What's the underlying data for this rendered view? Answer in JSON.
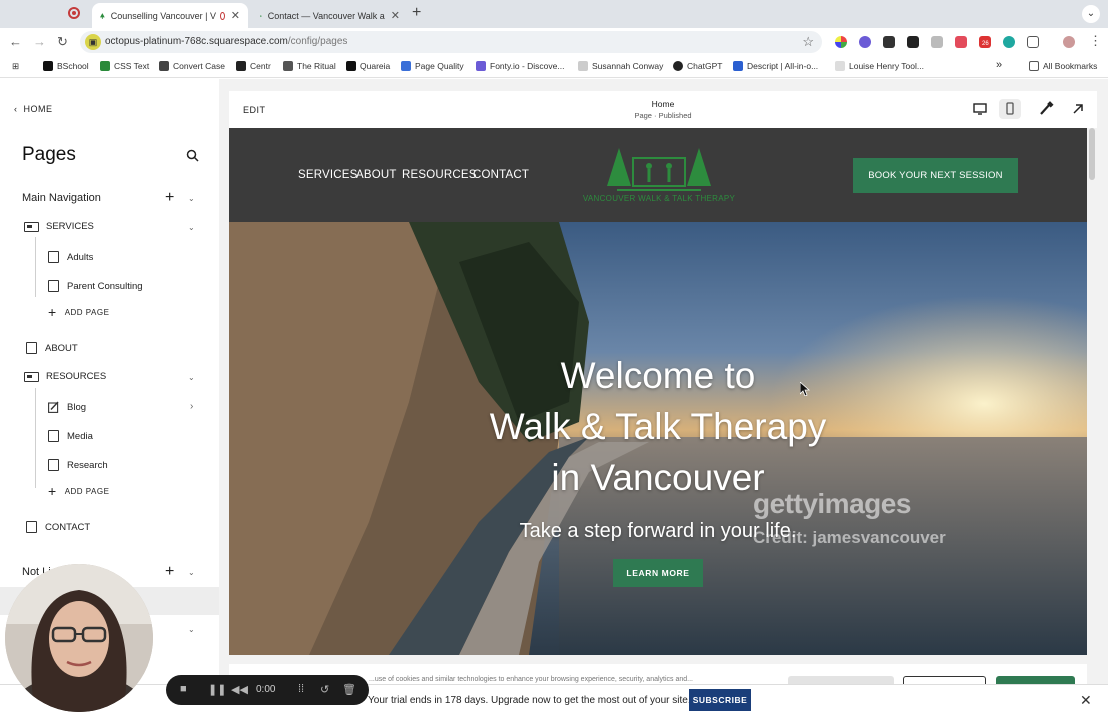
{
  "browser": {
    "tabs": [
      {
        "title": "Counselling Vancouver | V"
      },
      {
        "title": "Contact — Vancouver Walk a"
      }
    ],
    "new_tab": "+",
    "url_host": "octopus-platinum-768c.squarespace.com",
    "url_path": "/config/pages",
    "bookmarks": [
      "BSchool",
      "CSS Text",
      "Convert Case",
      "Centr",
      "The Ritual",
      "Quareia",
      "Page Quality",
      "Fonty.io - Discove...",
      "Susannah Conway",
      "ChatGPT",
      "Descript | All-in-o...",
      "Louise Henry Tool...",
      "All Bookmarks"
    ],
    "extension_badge": "26"
  },
  "sidebar": {
    "home_label": "HOME",
    "title": "Pages",
    "main_nav_label": "Main Navigation",
    "items": {
      "services": "SERVICES",
      "adults": "Adults",
      "parent_consulting": "Parent Consulting",
      "add_page_1": "ADD PAGE",
      "about": "ABOUT",
      "resources": "RESOURCES",
      "blog": "Blog",
      "media": "Media",
      "research": "Research",
      "add_page_2": "ADD PAGE",
      "contact": "CONTACT"
    },
    "not_linked_label": "Not Li"
  },
  "editor": {
    "edit_label": "EDIT",
    "page_name": "Home",
    "page_status": "Page · Published"
  },
  "site": {
    "nav": [
      "SERVICES",
      "ABOUT",
      "RESOURCES",
      "CONTACT"
    ],
    "logo_text": "VANCOUVER WALK & TALK THERAPY",
    "book_button": "BOOK YOUR NEXT SESSION",
    "hero_line1": "Welcome to",
    "hero_line2": "Walk & Talk Therapy",
    "hero_line3": "in Vancouver",
    "hero_subtitle": "Take a step forward in your life.",
    "learn_more": "LEARN MORE",
    "watermark": "gettyimages",
    "credit": "Credit: jamesvancouver",
    "cookie_text": "...use of cookies and similar technologies to enhance your browsing experience, security, analytics and..."
  },
  "trial": {
    "text": "Your trial ends in 178 days. Upgrade now to get the most out of your site.",
    "subscribe": "SUBSCRIBE"
  },
  "recorder": {
    "time": "0:00"
  },
  "colors": {
    "brand_green": "#2f7a52",
    "header_bg": "#3b3b3b",
    "subscribe_blue": "#1a3e7a"
  }
}
